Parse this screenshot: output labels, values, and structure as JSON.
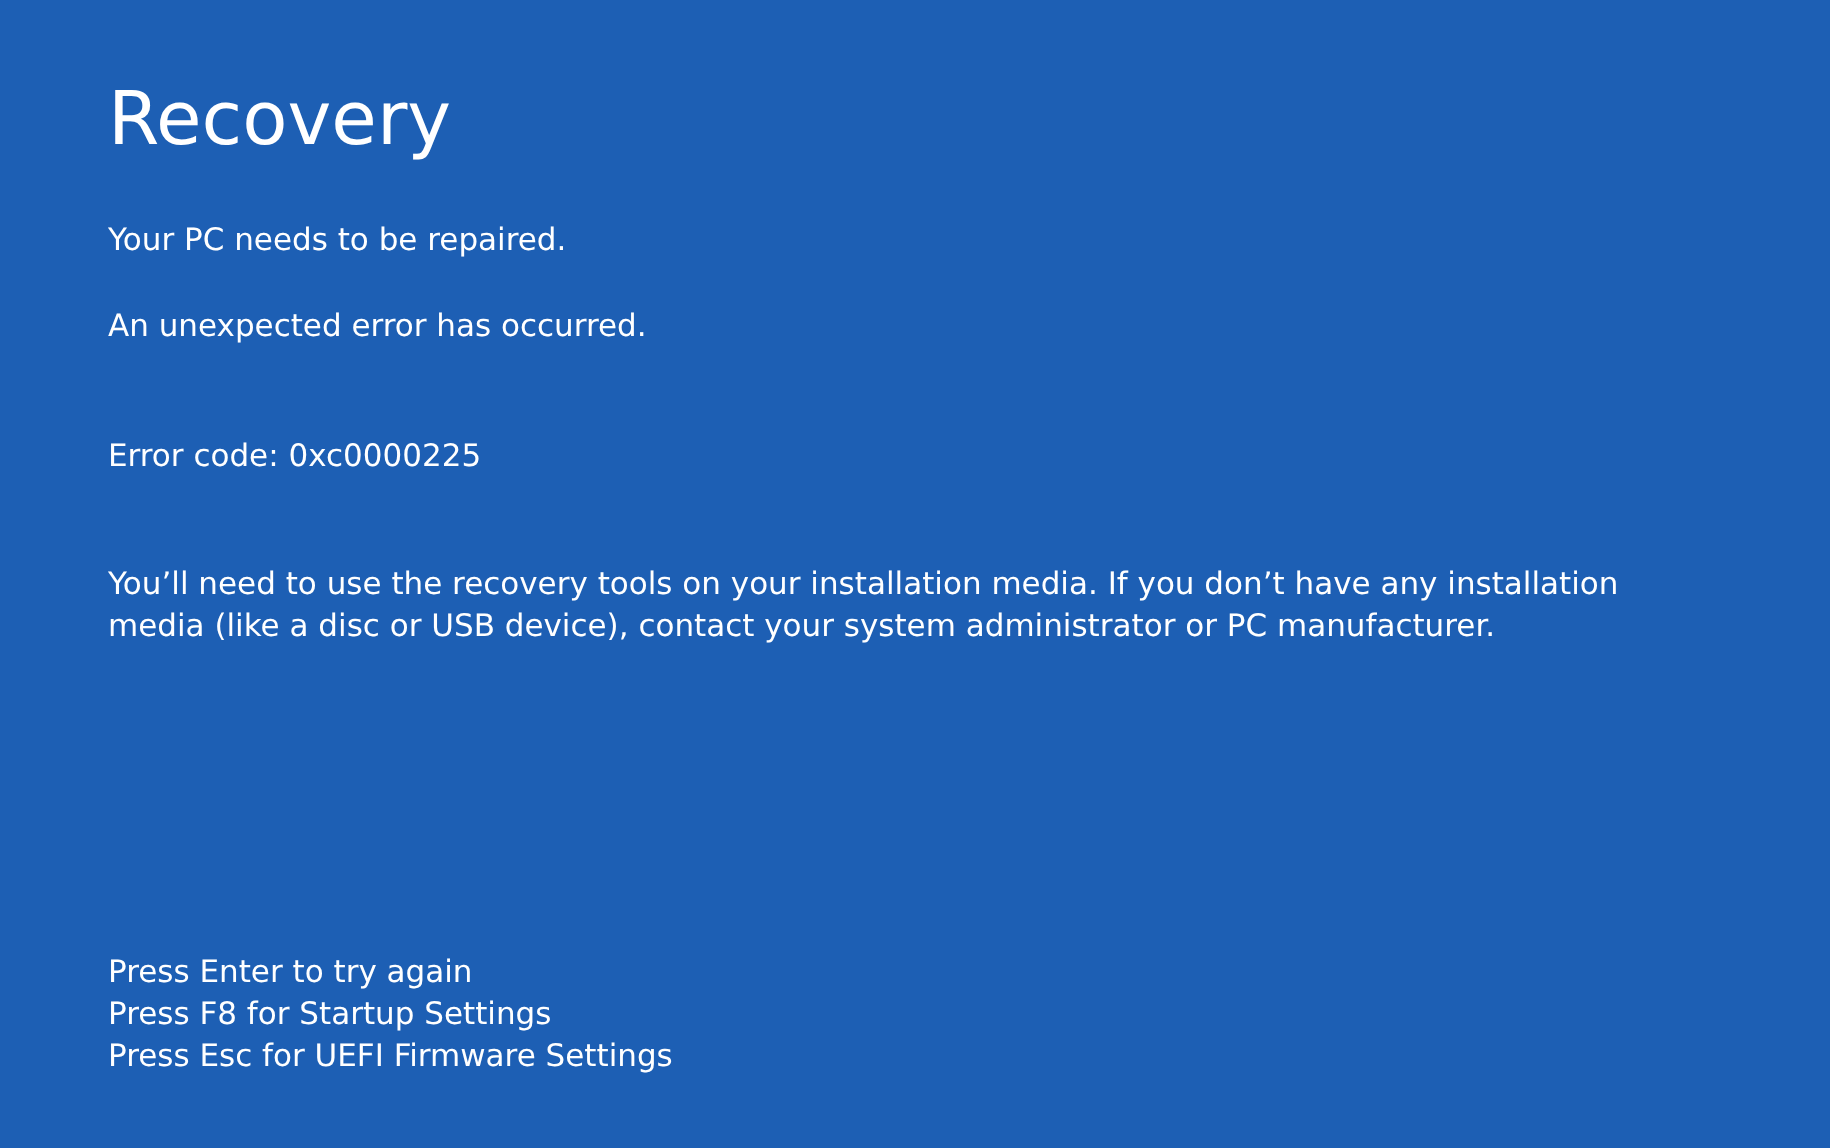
{
  "title": "Recovery",
  "messages": [
    "Your PC needs to be repaired.",
    "An unexpected error has occurred."
  ],
  "error_code": "Error code: 0xc0000225",
  "instructions": [
    "You’ll need to use the recovery tools on your installation media. If you don’t have any installation",
    "media (like a disc or USB device), contact your system administrator or PC manufacturer."
  ],
  "key_options": [
    "Press Enter to try again",
    "Press F8 for Startup Settings",
    "Press Esc for UEFI Firmware Settings"
  ]
}
